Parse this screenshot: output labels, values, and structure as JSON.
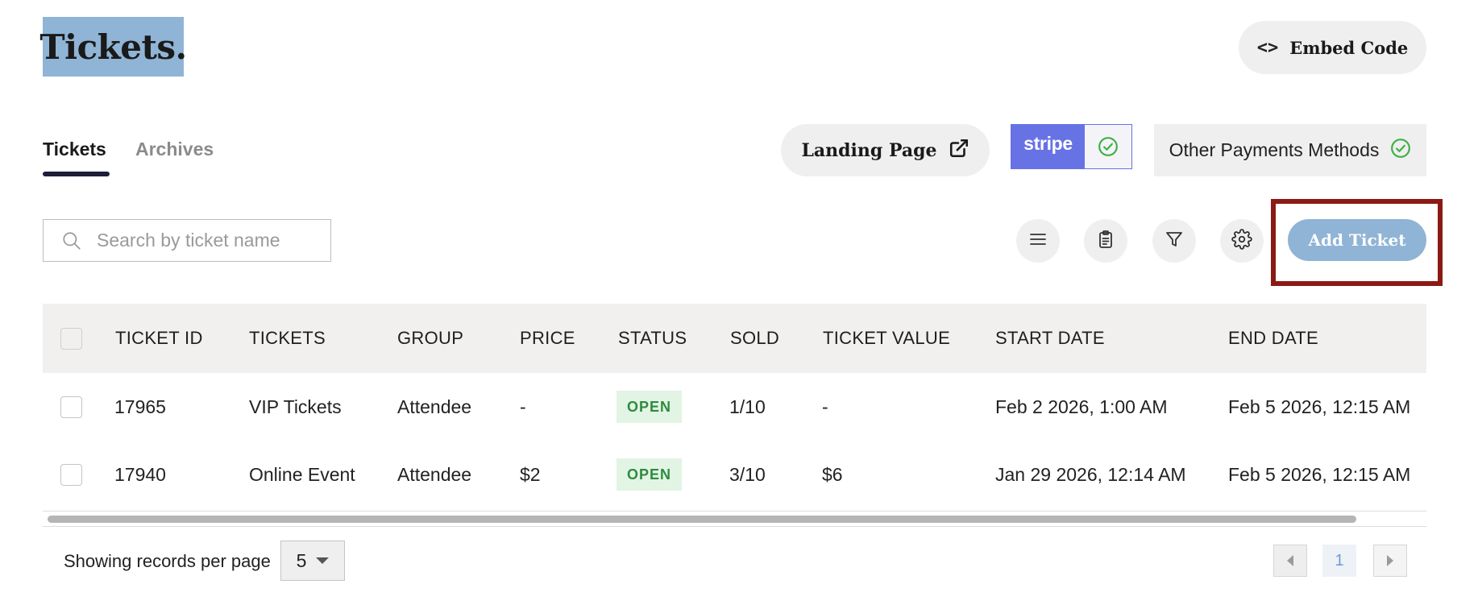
{
  "page": {
    "title": "Tickets."
  },
  "header": {
    "embed_label": "Embed Code",
    "embed_icon": "code-icon"
  },
  "tabs": [
    {
      "label": "Tickets",
      "active": true
    },
    {
      "label": "Archives",
      "active": false
    }
  ],
  "actions": {
    "landing_label": "Landing Page",
    "stripe_label": "stripe",
    "other_payments_label": "Other Payments Methods",
    "add_ticket_label": "Add Ticket"
  },
  "search": {
    "placeholder": "Search by ticket name",
    "value": ""
  },
  "toolbar_icons": [
    "menu-icon",
    "clipboard-icon",
    "filter-icon",
    "gear-icon"
  ],
  "table": {
    "columns": [
      "TICKET ID",
      "TICKETS",
      "GROUP",
      "PRICE",
      "STATUS",
      "SOLD",
      "TICKET VALUE",
      "START DATE",
      "END DATE"
    ],
    "rows": [
      {
        "id": "17965",
        "name": "VIP Tickets",
        "group": "Attendee",
        "price": "-",
        "status": "OPEN",
        "sold": "1/10",
        "value": "-",
        "start": "Feb 2 2026, 1:00 AM",
        "end": "Feb 5 2026, 12:15 AM"
      },
      {
        "id": "17940",
        "name": "Online Event",
        "group": "Attendee",
        "price": "$2",
        "status": "OPEN",
        "sold": "3/10",
        "value": "$6",
        "start": "Jan 29 2026, 12:14 AM",
        "end": "Feb 5 2026, 12:15 AM"
      }
    ]
  },
  "footer": {
    "per_page_label": "Showing records per page",
    "per_page_value": "5",
    "current_page": "1"
  },
  "colors": {
    "accent": "#8fb4d5",
    "stripe": "#6772e5",
    "highlight_border": "#8b1a14",
    "status_open": "#2e8b3e"
  }
}
